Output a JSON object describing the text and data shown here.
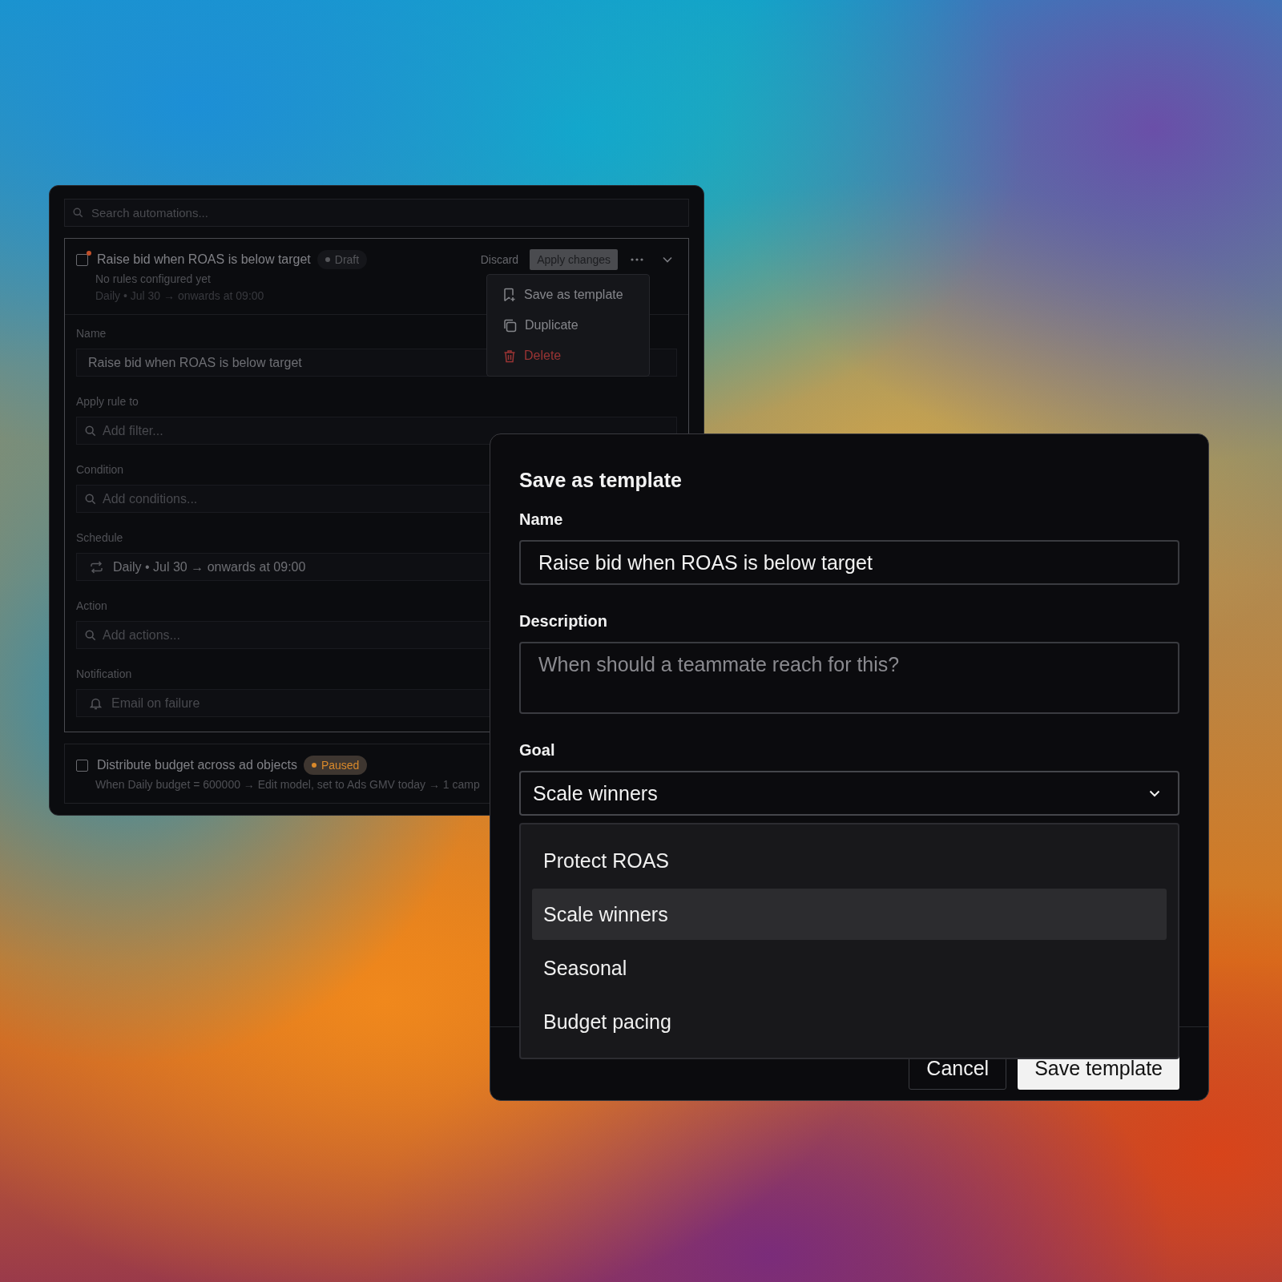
{
  "search": {
    "placeholder": "Search automations..."
  },
  "automations": [
    {
      "title": "Raise bid when ROAS is below target",
      "checked": false,
      "unsaved": true,
      "status": {
        "label": "Draft",
        "color": "#55565a"
      },
      "expanded": true,
      "subtitle": "No rules configured yet",
      "schedule_line": "Daily • Jul 30 → onwards at 09:00",
      "discard": "Discard",
      "apply": "Apply changes",
      "menu": [
        {
          "label": "Save as template",
          "destructive": false
        },
        {
          "label": "Duplicate",
          "destructive": false
        },
        {
          "label": "Delete",
          "destructive": true
        }
      ],
      "fields": [
        {
          "label": "Name",
          "kind": "text",
          "value": "Raise bid when ROAS is below target"
        },
        {
          "label": "Apply rule to",
          "kind": "search",
          "placeholder": "Add filter..."
        },
        {
          "label": "Condition",
          "kind": "search",
          "placeholder": "Add conditions..."
        },
        {
          "label": "Schedule",
          "kind": "schedule",
          "value": "Daily • Jul 30 → onwards at 09:00"
        },
        {
          "label": "Action",
          "kind": "search",
          "placeholder": "Add actions..."
        },
        {
          "label": "Notification",
          "kind": "notification",
          "value": "Email on failure"
        }
      ]
    },
    {
      "title": "Distribute budget across ad objects",
      "checked": false,
      "unsaved": false,
      "status": {
        "label": "Paused",
        "color": "#d9892b"
      },
      "expanded": false,
      "subtitle": "When Daily budget = 600000 → Edit model, set to Ads GMV today → 1 camp"
    }
  ],
  "dialog": {
    "title": "Save as template",
    "name": {
      "label": "Name",
      "value": "Raise bid when ROAS is below target"
    },
    "description": {
      "label": "Description",
      "placeholder": "When should a teammate reach for this?"
    },
    "goal": {
      "label": "Goal",
      "value": "Scale winners",
      "expanded": true,
      "options": [
        {
          "label": "Protect ROAS",
          "selected": false
        },
        {
          "label": "Scale winners",
          "selected": true
        },
        {
          "label": "Seasonal",
          "selected": false
        },
        {
          "label": "Budget pacing",
          "selected": false
        }
      ]
    },
    "buttons": [
      {
        "label": "Cancel",
        "kind": "secondary"
      },
      {
        "label": "Save template",
        "kind": "primary"
      }
    ]
  }
}
